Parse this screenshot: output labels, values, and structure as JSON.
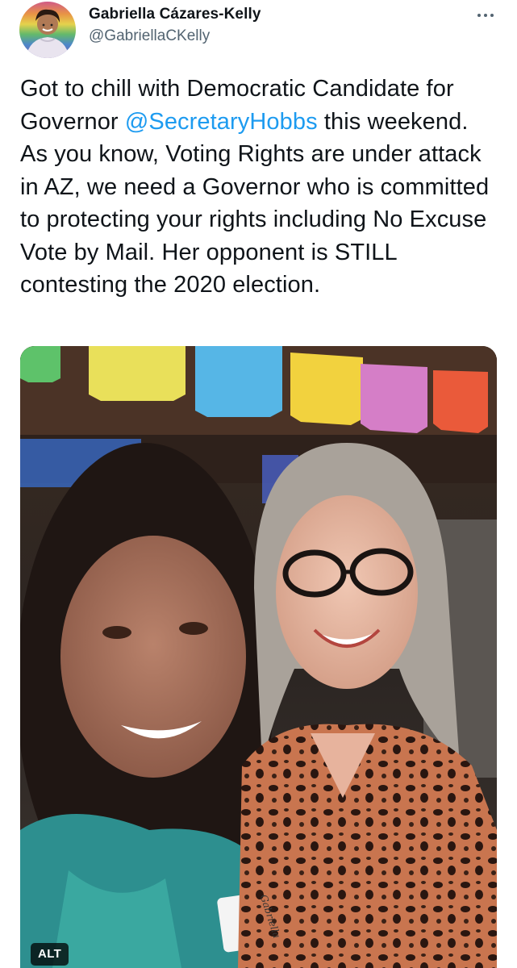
{
  "author": {
    "display_name": "Gabriella Cázares-Kelly",
    "handle": "@GabriellaCKelly"
  },
  "more_icon": "more-horizontal-icon",
  "tweet": {
    "text_before": "Got to chill with Democratic Candidate for Governor ",
    "mention": "@SecretaryHobbs",
    "text_after": " this weekend. As you know, Voting Rights are under attack in AZ, we need a Governor who is committed to protecting your rights including No Excuse Vote by Mail. Her opponent is STILL contesting the 2020 election."
  },
  "media": {
    "alt_label": "ALT",
    "name_tag": "Gabriella"
  },
  "colors": {
    "text": "#0f1419",
    "secondary": "#536471",
    "link": "#1d9bf0"
  }
}
